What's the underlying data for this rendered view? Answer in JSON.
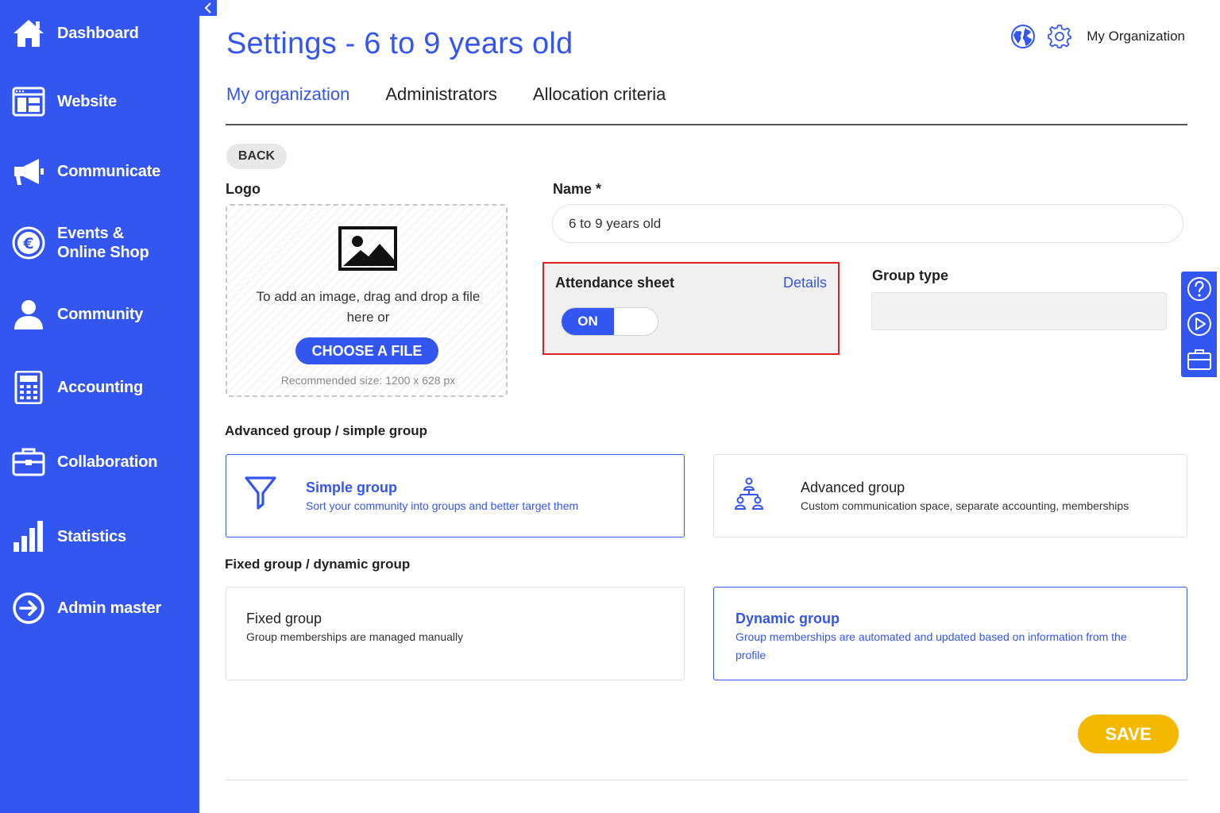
{
  "sidebar": {
    "items": [
      {
        "label": "Dashboard",
        "icon": "home-icon"
      },
      {
        "label": "Website",
        "icon": "website-icon"
      },
      {
        "label": "Communicate",
        "icon": "megaphone-icon"
      },
      {
        "label": "Events &\nOnline Shop",
        "icon": "euro-icon"
      },
      {
        "label": "Community",
        "icon": "user-icon"
      },
      {
        "label": "Accounting",
        "icon": "calculator-icon"
      },
      {
        "label": "Collaboration",
        "icon": "briefcase-icon"
      },
      {
        "label": "Statistics",
        "icon": "bar-chart-icon"
      },
      {
        "label": "Admin master",
        "icon": "arrow-circle-icon"
      }
    ]
  },
  "header": {
    "title": "Settings - 6 to 9 years old",
    "org_name": "My Organization"
  },
  "tabs": [
    {
      "label": "My organization",
      "active": true
    },
    {
      "label": "Administrators",
      "active": false
    },
    {
      "label": "Allocation criteria",
      "active": false
    }
  ],
  "form": {
    "back_label": "BACK",
    "logo_label": "Logo",
    "dropzone_text": "To add an image, drag and drop a file here or",
    "choose_file_label": "CHOOSE A FILE",
    "recommended_size": "Recommended size: 1200 x 628 px",
    "name_label": "Name *",
    "name_value": "6 to 9 years old",
    "attendance_label": "Attendance sheet",
    "details_label": "Details",
    "toggle_label": "ON",
    "group_type_label": "Group type",
    "group_type_value": "",
    "advanced_section_label": "Advanced group / simple group",
    "fixed_section_label": "Fixed group / dynamic group",
    "save_label": "SAVE"
  },
  "cards": {
    "simple": {
      "title": "Simple group",
      "desc": "Sort your community into groups and better target them",
      "selected": true
    },
    "advanced": {
      "title": "Advanced group",
      "desc": "Custom communication space, separate accounting, memberships",
      "selected": false
    },
    "fixed": {
      "title": "Fixed group",
      "desc": "Group memberships are managed manually",
      "selected": false
    },
    "dynamic": {
      "title": "Dynamic group",
      "desc": "Group memberships are automated and updated based on information from the profile",
      "selected": true
    }
  },
  "colors": {
    "brand": "#3355f0",
    "save": "#f5b800",
    "highlight": "#e02020"
  }
}
